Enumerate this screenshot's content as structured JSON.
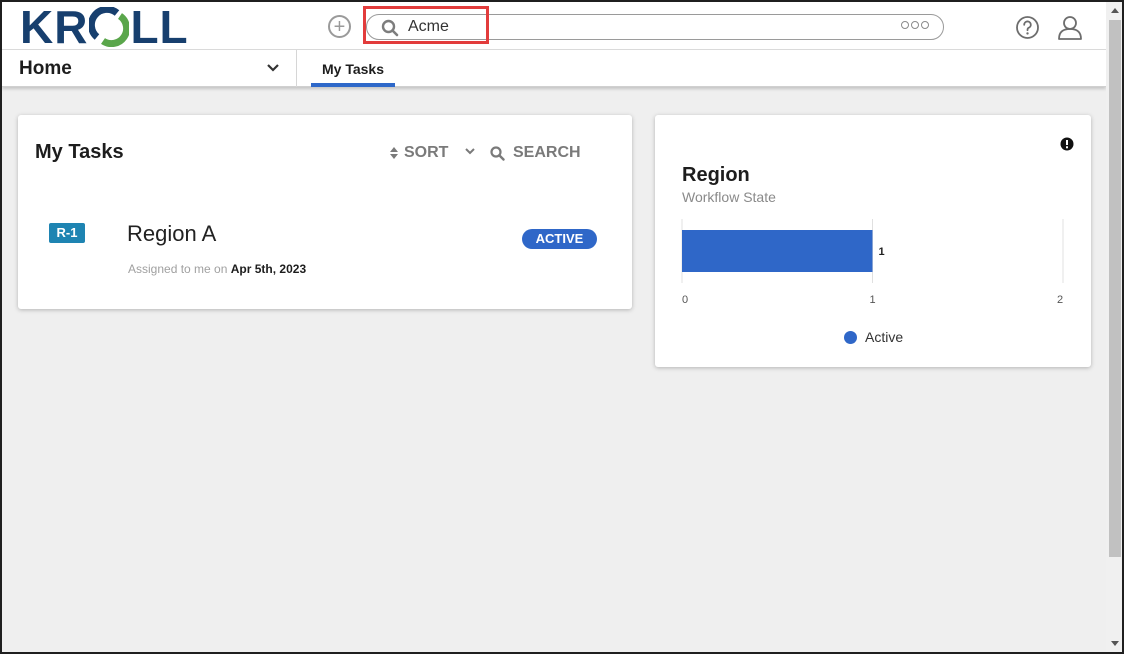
{
  "header": {
    "logo_text_k": "KR",
    "logo_text_end": "LL",
    "search": {
      "value": "Acme"
    },
    "add_icon": "plus-circle-icon",
    "help_icon": "question-circle-icon",
    "user_icon": "user-icon"
  },
  "nav": {
    "home_label": "Home",
    "tabs": [
      {
        "label": "My Tasks",
        "active": true
      }
    ]
  },
  "tasks_card": {
    "title": "My Tasks",
    "sort_label": "SORT",
    "search_label": "SEARCH",
    "items": [
      {
        "id": "R-1",
        "name": "Region A",
        "assigned_prefix": "Assigned to me on",
        "date": "Apr 5th, 2023",
        "status": "ACTIVE"
      }
    ]
  },
  "region_card": {
    "title": "Region",
    "subtitle": "Workflow State"
  },
  "chart_data": {
    "type": "bar",
    "orientation": "horizontal",
    "title": "Region",
    "subtitle": "Workflow State",
    "categories": [
      ""
    ],
    "series": [
      {
        "name": "Active",
        "values": [
          1
        ],
        "color": "#2f67c8"
      }
    ],
    "data_labels": [
      "1"
    ],
    "xlim": [
      0,
      2
    ],
    "x_ticks": [
      "0",
      "1",
      "2"
    ],
    "legend": "bottom-center",
    "grid": true
  },
  "colors": {
    "brand_navy": "#173f6e",
    "brand_green": "#5aa64b",
    "accent_blue": "#2f67c8",
    "id_badge": "#1e84b2",
    "highlight_red": "#e23c3c"
  }
}
